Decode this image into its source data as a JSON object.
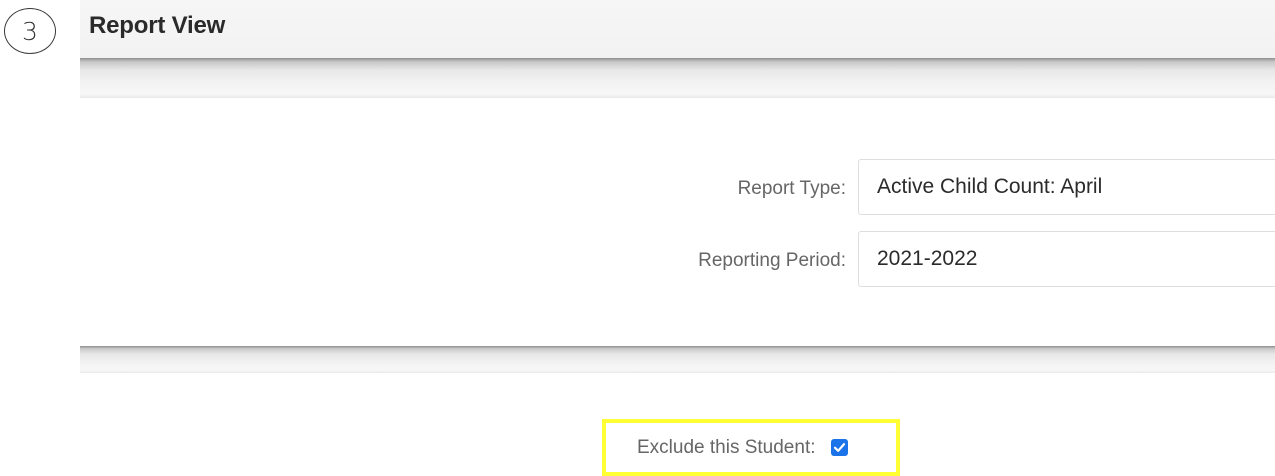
{
  "step_number": "3",
  "header": {
    "title": "Report View"
  },
  "form": {
    "report_type": {
      "label": "Report Type:",
      "value": "Active Child Count: April"
    },
    "reporting_period": {
      "label": "Reporting Period:",
      "value": "2021-2022"
    }
  },
  "exclude": {
    "label": "Exclude this Student:",
    "checked": true
  },
  "colors": {
    "checkbox_fill": "#1a73e8",
    "highlight_border": "#ffff33",
    "label_text": "#666666",
    "title_text": "#2a2a2a"
  },
  "icons": {
    "checkbox": "check-mark-icon"
  }
}
